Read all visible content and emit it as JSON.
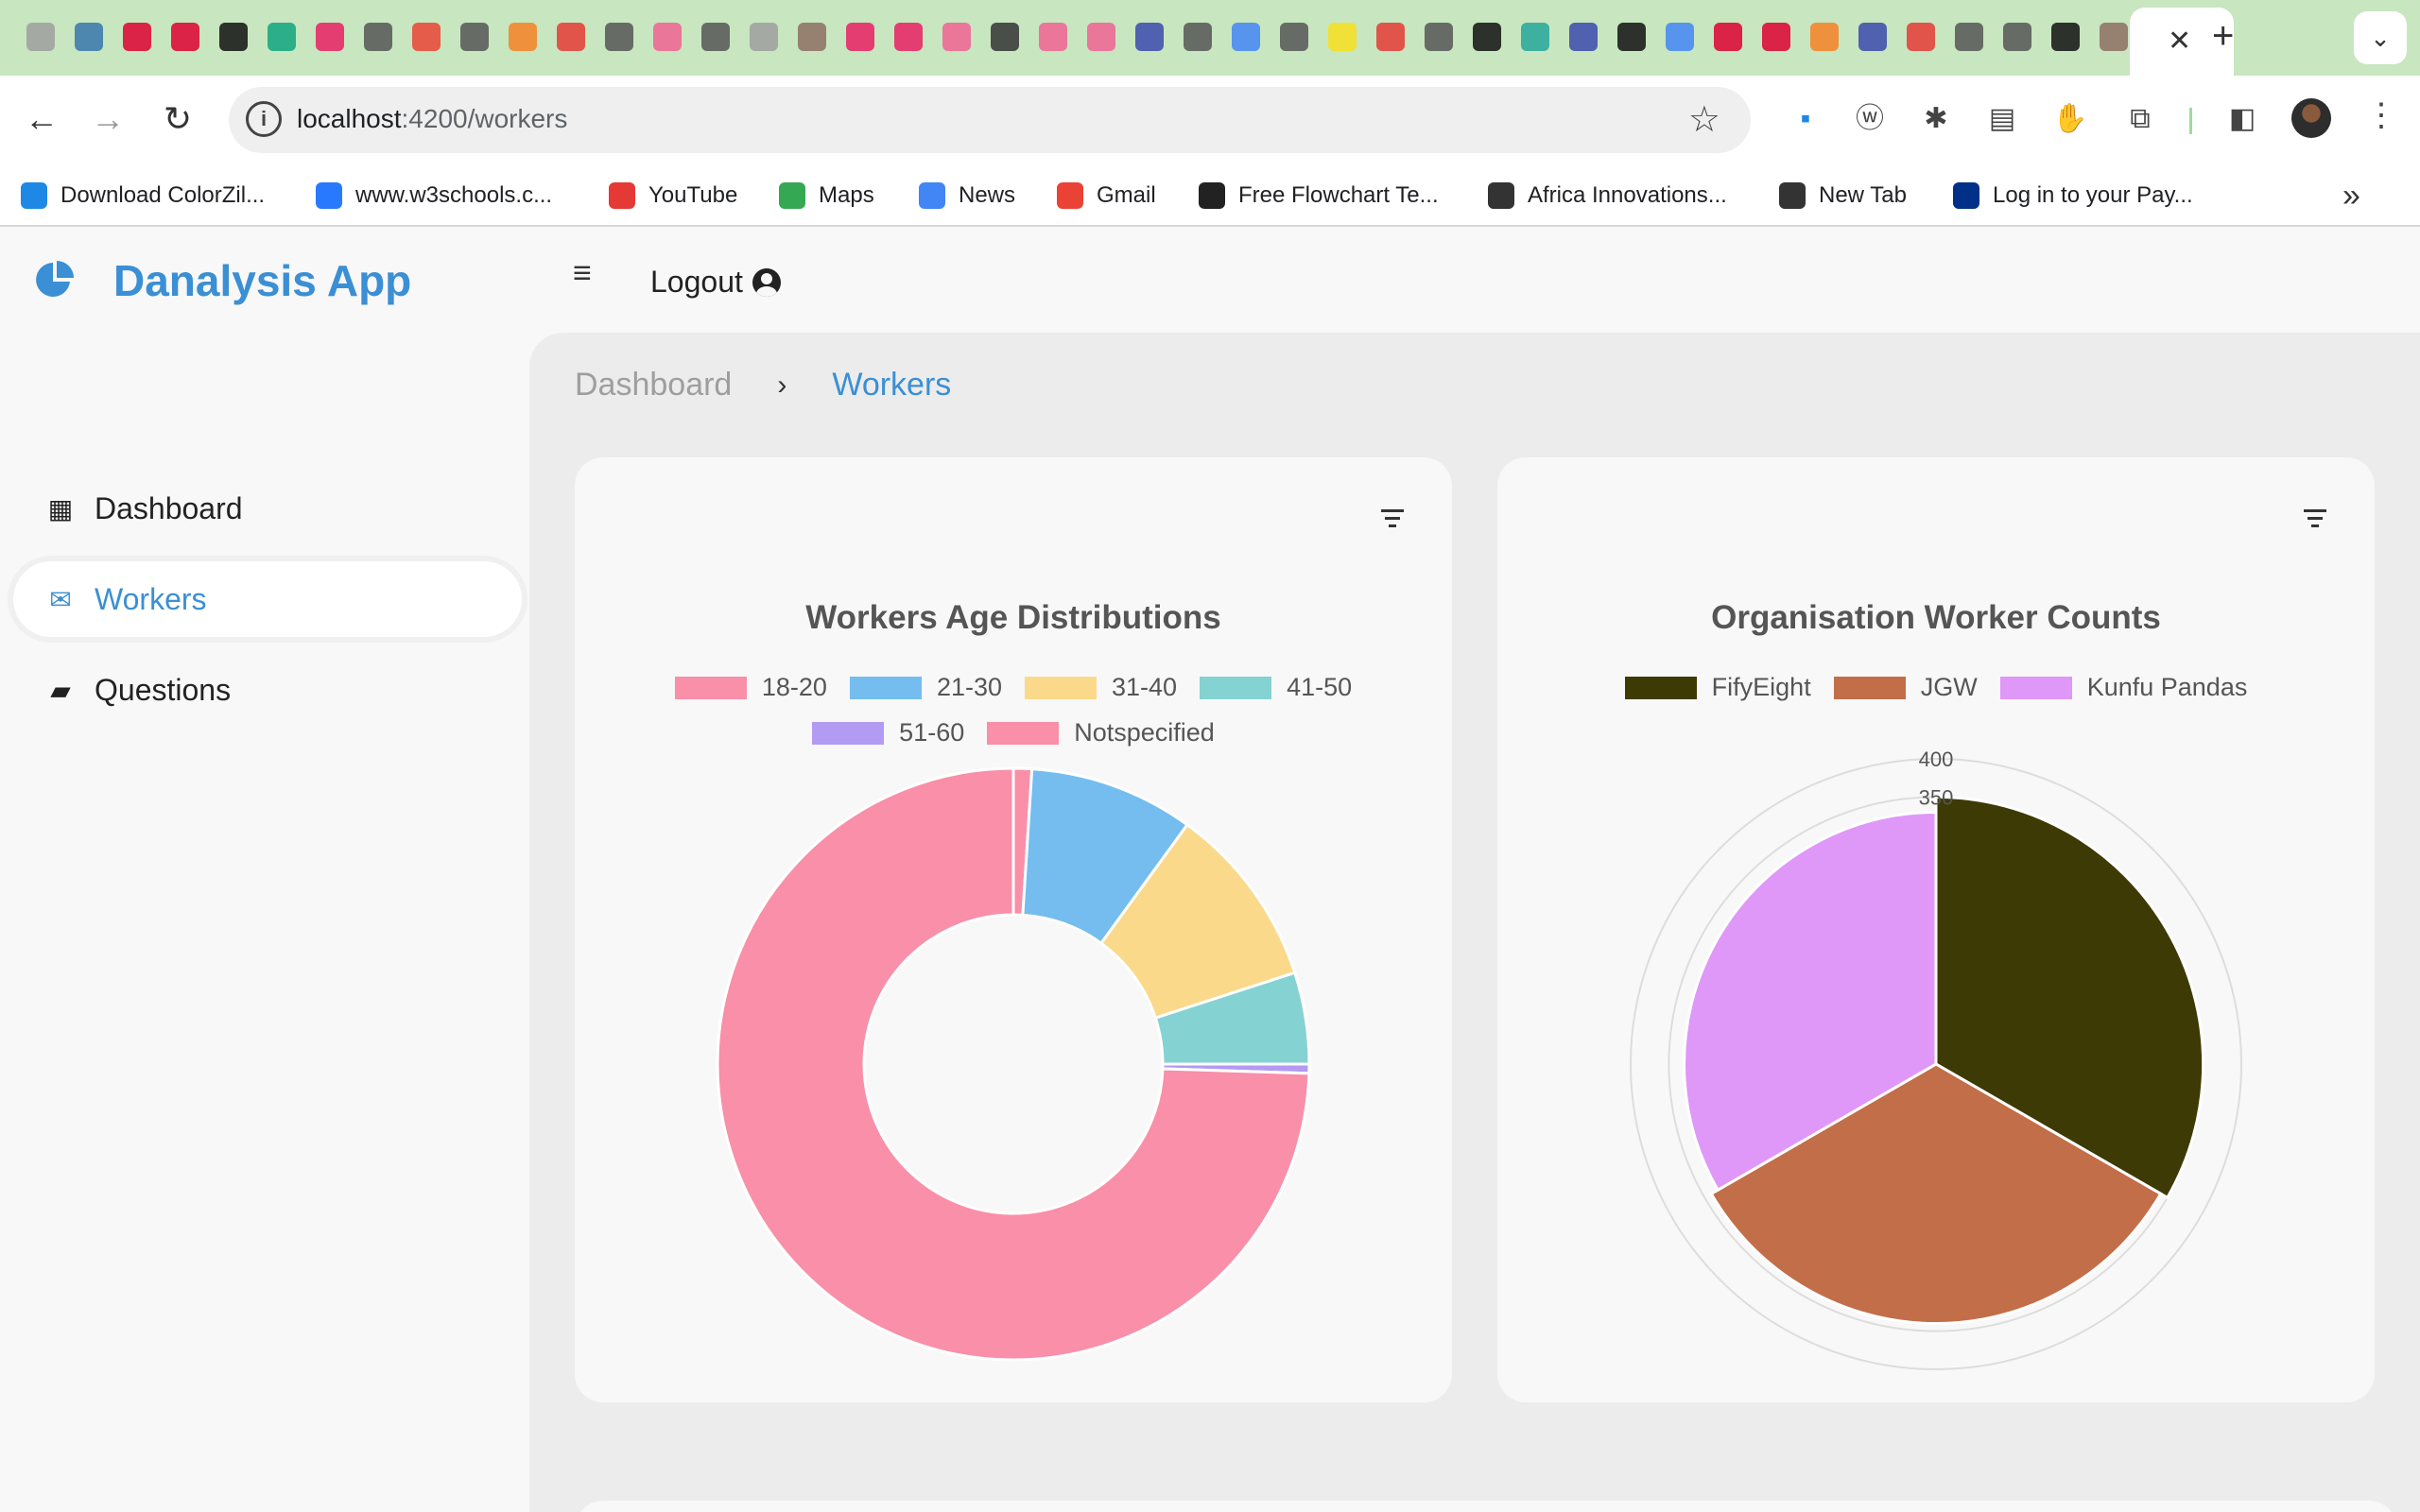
{
  "browser": {
    "url_host": "localhost",
    "url_path": ":4200/workers",
    "tab_close": "✕",
    "new_tab": "+",
    "tab_list": "⌄",
    "bookmarks": [
      {
        "label": "Download ColorZil...",
        "icon": "colorzilla-icon",
        "color": "#1e88e5"
      },
      {
        "label": "www.w3schools.c...",
        "icon": "w3schools-icon",
        "color": "#2979ff"
      },
      {
        "label": "YouTube",
        "icon": "youtube-icon",
        "color": "#e53935"
      },
      {
        "label": "Maps",
        "icon": "maps-icon",
        "color": "#34a853"
      },
      {
        "label": "News",
        "icon": "news-icon",
        "color": "#4285f4"
      },
      {
        "label": "Gmail",
        "icon": "gmail-icon",
        "color": "#ea4335"
      },
      {
        "label": "Free Flowchart Te...",
        "icon": "flowchart-icon",
        "color": "#222222"
      },
      {
        "label": "Africa Innovations...",
        "icon": "globe-icon",
        "color": "#333333"
      },
      {
        "label": "New Tab",
        "icon": "globe-icon",
        "color": "#333333"
      },
      {
        "label": "Log in to your Pay...",
        "icon": "paypal-icon",
        "color": "#003087"
      }
    ],
    "bookmarks_more": "»"
  },
  "app": {
    "title": "Danalysis App",
    "logout_label": "Logout",
    "accent": "#3b8fd4"
  },
  "sidebar": {
    "items": [
      {
        "label": "Dashboard",
        "icon": "dashboard-icon",
        "active": false
      },
      {
        "label": "Workers",
        "icon": "mail-icon",
        "active": true
      },
      {
        "label": "Questions",
        "icon": "comment-icon",
        "active": false
      }
    ]
  },
  "breadcrumb": {
    "home": "Dashboard",
    "separator": "›",
    "current": "Workers"
  },
  "chart_data": [
    {
      "type": "pie",
      "variant": "doughnut",
      "title": "Workers Age Distributions",
      "categories": [
        "18-20",
        "21-30",
        "31-40",
        "41-50",
        "51-60",
        "Notspecified"
      ],
      "values": [
        1,
        9,
        10,
        5,
        0.5,
        74.5
      ],
      "colors": [
        "#f98fa8",
        "#74bdee",
        "#fbd98b",
        "#85d2d2",
        "#b29bf2",
        "#f98fa8"
      ],
      "legend_position": "top"
    },
    {
      "type": "pie",
      "variant": "polarArea",
      "title": "Organisation Worker Counts",
      "categories": [
        "FifyEight",
        "JGW",
        "Kunfu Pandas"
      ],
      "values": [
        350,
        340,
        330
      ],
      "radial_ticks": [
        "400",
        "350"
      ],
      "rmax": 400,
      "colors": [
        "#3d3a05",
        "#c26e48",
        "#df97f8"
      ],
      "legend_position": "top"
    }
  ]
}
